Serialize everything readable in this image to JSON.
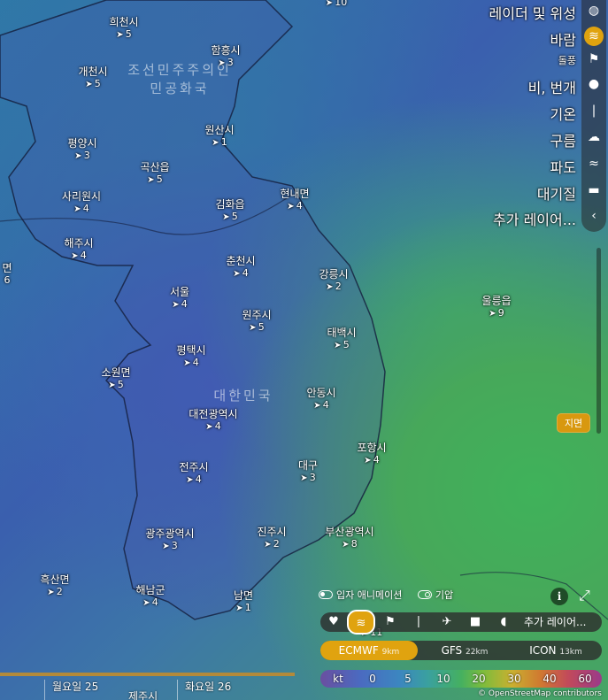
{
  "places": [
    {
      "name": "희천시",
      "value": "5"
    },
    {
      "name": "함흥시",
      "value": "3"
    },
    {
      "name": "개천시",
      "value": "5"
    },
    {
      "name": "원산시",
      "value": "1"
    },
    {
      "name": "평양시",
      "value": "3"
    },
    {
      "name": "곡산읍",
      "value": "5"
    },
    {
      "name": "사리원시",
      "value": "4"
    },
    {
      "name": "김화읍",
      "value": "5"
    },
    {
      "name": "현내면",
      "value": "4"
    },
    {
      "name": "해주시",
      "value": "4"
    },
    {
      "name": "면",
      "value": "6"
    },
    {
      "name": "춘천시",
      "value": "4"
    },
    {
      "name": "강릉시",
      "value": "2"
    },
    {
      "name": "울릉읍",
      "value": "9"
    },
    {
      "name": "서울",
      "value": "4"
    },
    {
      "name": "원주시",
      "value": "5"
    },
    {
      "name": "태백시",
      "value": "5"
    },
    {
      "name": "평택시",
      "value": "4"
    },
    {
      "name": "소원면",
      "value": "5"
    },
    {
      "name": "안동시",
      "value": "4"
    },
    {
      "name": "대전광역시",
      "value": "4"
    },
    {
      "name": "포항시",
      "value": "4"
    },
    {
      "name": "전주시",
      "value": "4"
    },
    {
      "name": "대구",
      "value": "3"
    },
    {
      "name": "광주광역시",
      "value": "3"
    },
    {
      "name": "진주시",
      "value": "2"
    },
    {
      "name": "부산광역시",
      "value": "8"
    },
    {
      "name": "흑산면",
      "value": "2"
    },
    {
      "name": "해남군",
      "value": "4"
    },
    {
      "name": "남면",
      "value": "1"
    },
    {
      "name": "",
      "value": "11"
    },
    {
      "name": "",
      "value": "10"
    }
  ],
  "countries": {
    "north": "조선민주주의인민공화국",
    "north_line1": "조선민주주의인",
    "north_line2": "민공화국",
    "south": "대한민국"
  },
  "layers": [
    {
      "label": "레이더 및 위성",
      "icon": "globe-icon"
    },
    {
      "label": "바람",
      "icon": "wind-icon",
      "active": true
    },
    {
      "label": "돌풍",
      "icon": "flag-icon"
    },
    {
      "label": "비, 번개",
      "icon": "drop-icon"
    },
    {
      "label": "기온",
      "icon": "thermometer-icon"
    },
    {
      "label": "구름",
      "icon": "cloud-icon"
    },
    {
      "label": "파도",
      "icon": "waves-icon"
    },
    {
      "label": "대기질",
      "icon": "car-icon"
    },
    {
      "label": "추가 레이어...",
      "icon": "chevron-left-icon"
    }
  ],
  "pin_label": "지면",
  "toggles": {
    "particles": "입자 애니메이션",
    "pressure": "기압"
  },
  "toolbar": {
    "more_layers": "추가 레이어..."
  },
  "models": [
    {
      "name": "ECMWF",
      "res": "9km",
      "active": true
    },
    {
      "name": "GFS",
      "res": "22km"
    },
    {
      "name": "ICON",
      "res": "13km"
    }
  ],
  "legend": {
    "unit": "kt",
    "values": [
      "0",
      "5",
      "10",
      "20",
      "30",
      "40",
      "60"
    ]
  },
  "attribution": "© OpenStreetMap contributors",
  "timeline": {
    "days": [
      "월요일 25",
      "화요일 26"
    ]
  },
  "jeju": "제주시",
  "colors": {
    "accent": "#e0a30f"
  }
}
